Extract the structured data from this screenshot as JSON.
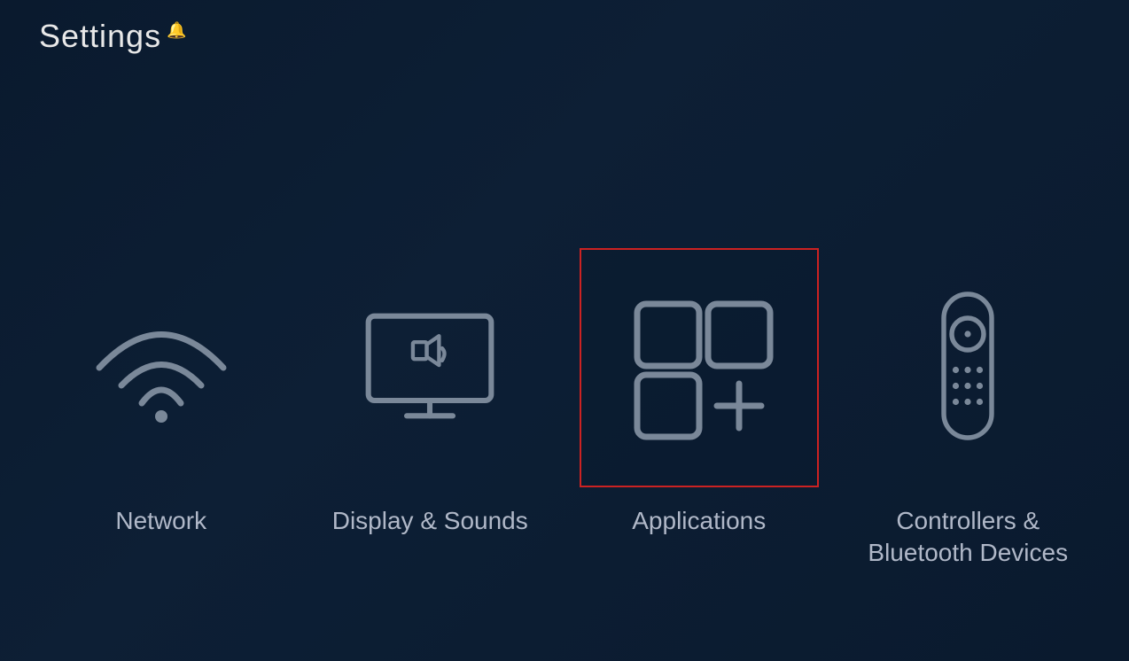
{
  "page": {
    "title": "Settings",
    "bell_icon": "🔔"
  },
  "items": [
    {
      "id": "network",
      "label": "Network",
      "selected": false
    },
    {
      "id": "display-sounds",
      "label": "Display & Sounds",
      "selected": false
    },
    {
      "id": "applications",
      "label": "Applications",
      "selected": true
    },
    {
      "id": "controllers",
      "label": "Controllers &\nBluetooth Devices",
      "selected": false
    }
  ],
  "colors": {
    "background": "#0a1a2e",
    "icon_stroke": "#7a8899",
    "selected_border": "#cc2222",
    "label_color": "#b0b8c8",
    "title_color": "#e8e8e8"
  }
}
